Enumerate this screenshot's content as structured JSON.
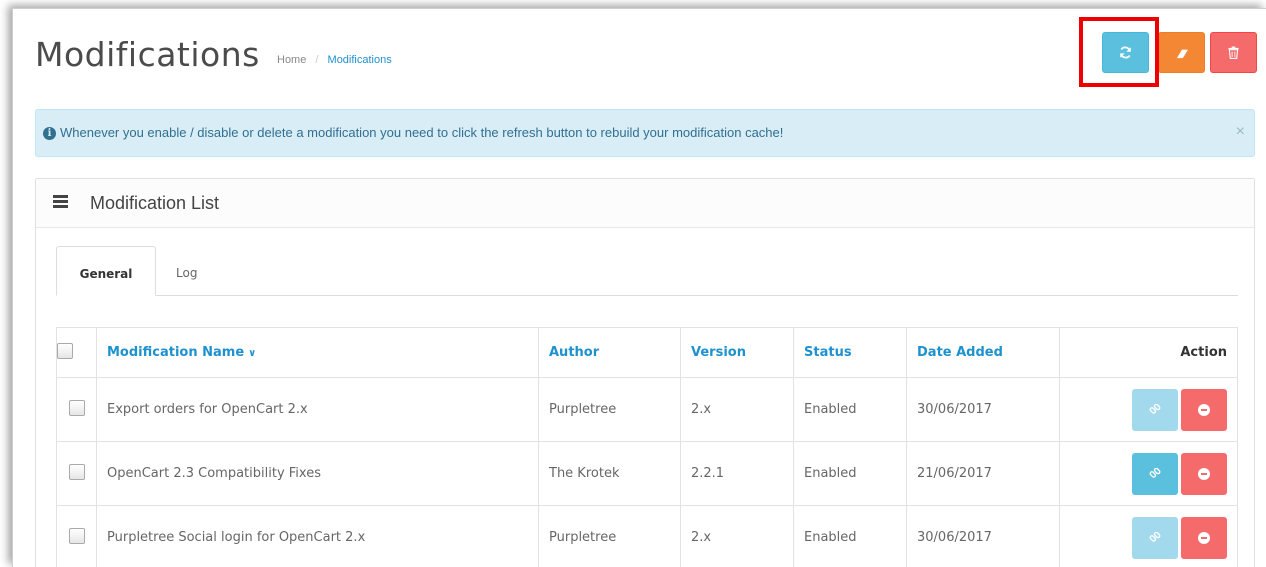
{
  "header": {
    "title": "Modifications",
    "breadcrumb": [
      {
        "label": "Home"
      },
      {
        "label": "Modifications"
      }
    ],
    "separator": "/",
    "buttons": [
      {
        "name": "refresh",
        "icon": "refresh-icon",
        "color": "#5bc0de"
      },
      {
        "name": "clear",
        "icon": "eraser-icon",
        "color": "#f38733"
      },
      {
        "name": "delete",
        "icon": "trash-icon",
        "color": "#f56b6b"
      }
    ]
  },
  "alert": {
    "icon": "info-circle-icon",
    "text": "Whenever you enable / disable or delete a modification you need to click the refresh button to rebuild your modification cache!",
    "close": "×"
  },
  "panel": {
    "icon": "list-icon",
    "title": "Modification List",
    "tabs": [
      {
        "label": "General",
        "active": true
      },
      {
        "label": "Log",
        "active": false
      }
    ]
  },
  "table": {
    "columns": {
      "name": "Modification Name",
      "author": "Author",
      "version": "Version",
      "status": "Status",
      "date": "Date Added",
      "action": "Action"
    },
    "rows": [
      {
        "name": "Export orders for OpenCart 2.x",
        "author": "Purpletree",
        "version": "2.x",
        "status": "Enabled",
        "date": "30/06/2017",
        "link_enabled": false
      },
      {
        "name": "OpenCart 2.3 Compatibility Fixes",
        "author": "The Krotek",
        "version": "2.2.1",
        "status": "Enabled",
        "date": "21/06/2017",
        "link_enabled": true
      },
      {
        "name": "Purpletree Social login for OpenCart 2.x",
        "author": "Purpletree",
        "version": "2.x",
        "status": "Enabled",
        "date": "30/06/2017",
        "link_enabled": false
      }
    ]
  },
  "colors": {
    "accent": "#1e91cf",
    "info_bg": "#d9edf7",
    "highlight": "#ee0000"
  }
}
